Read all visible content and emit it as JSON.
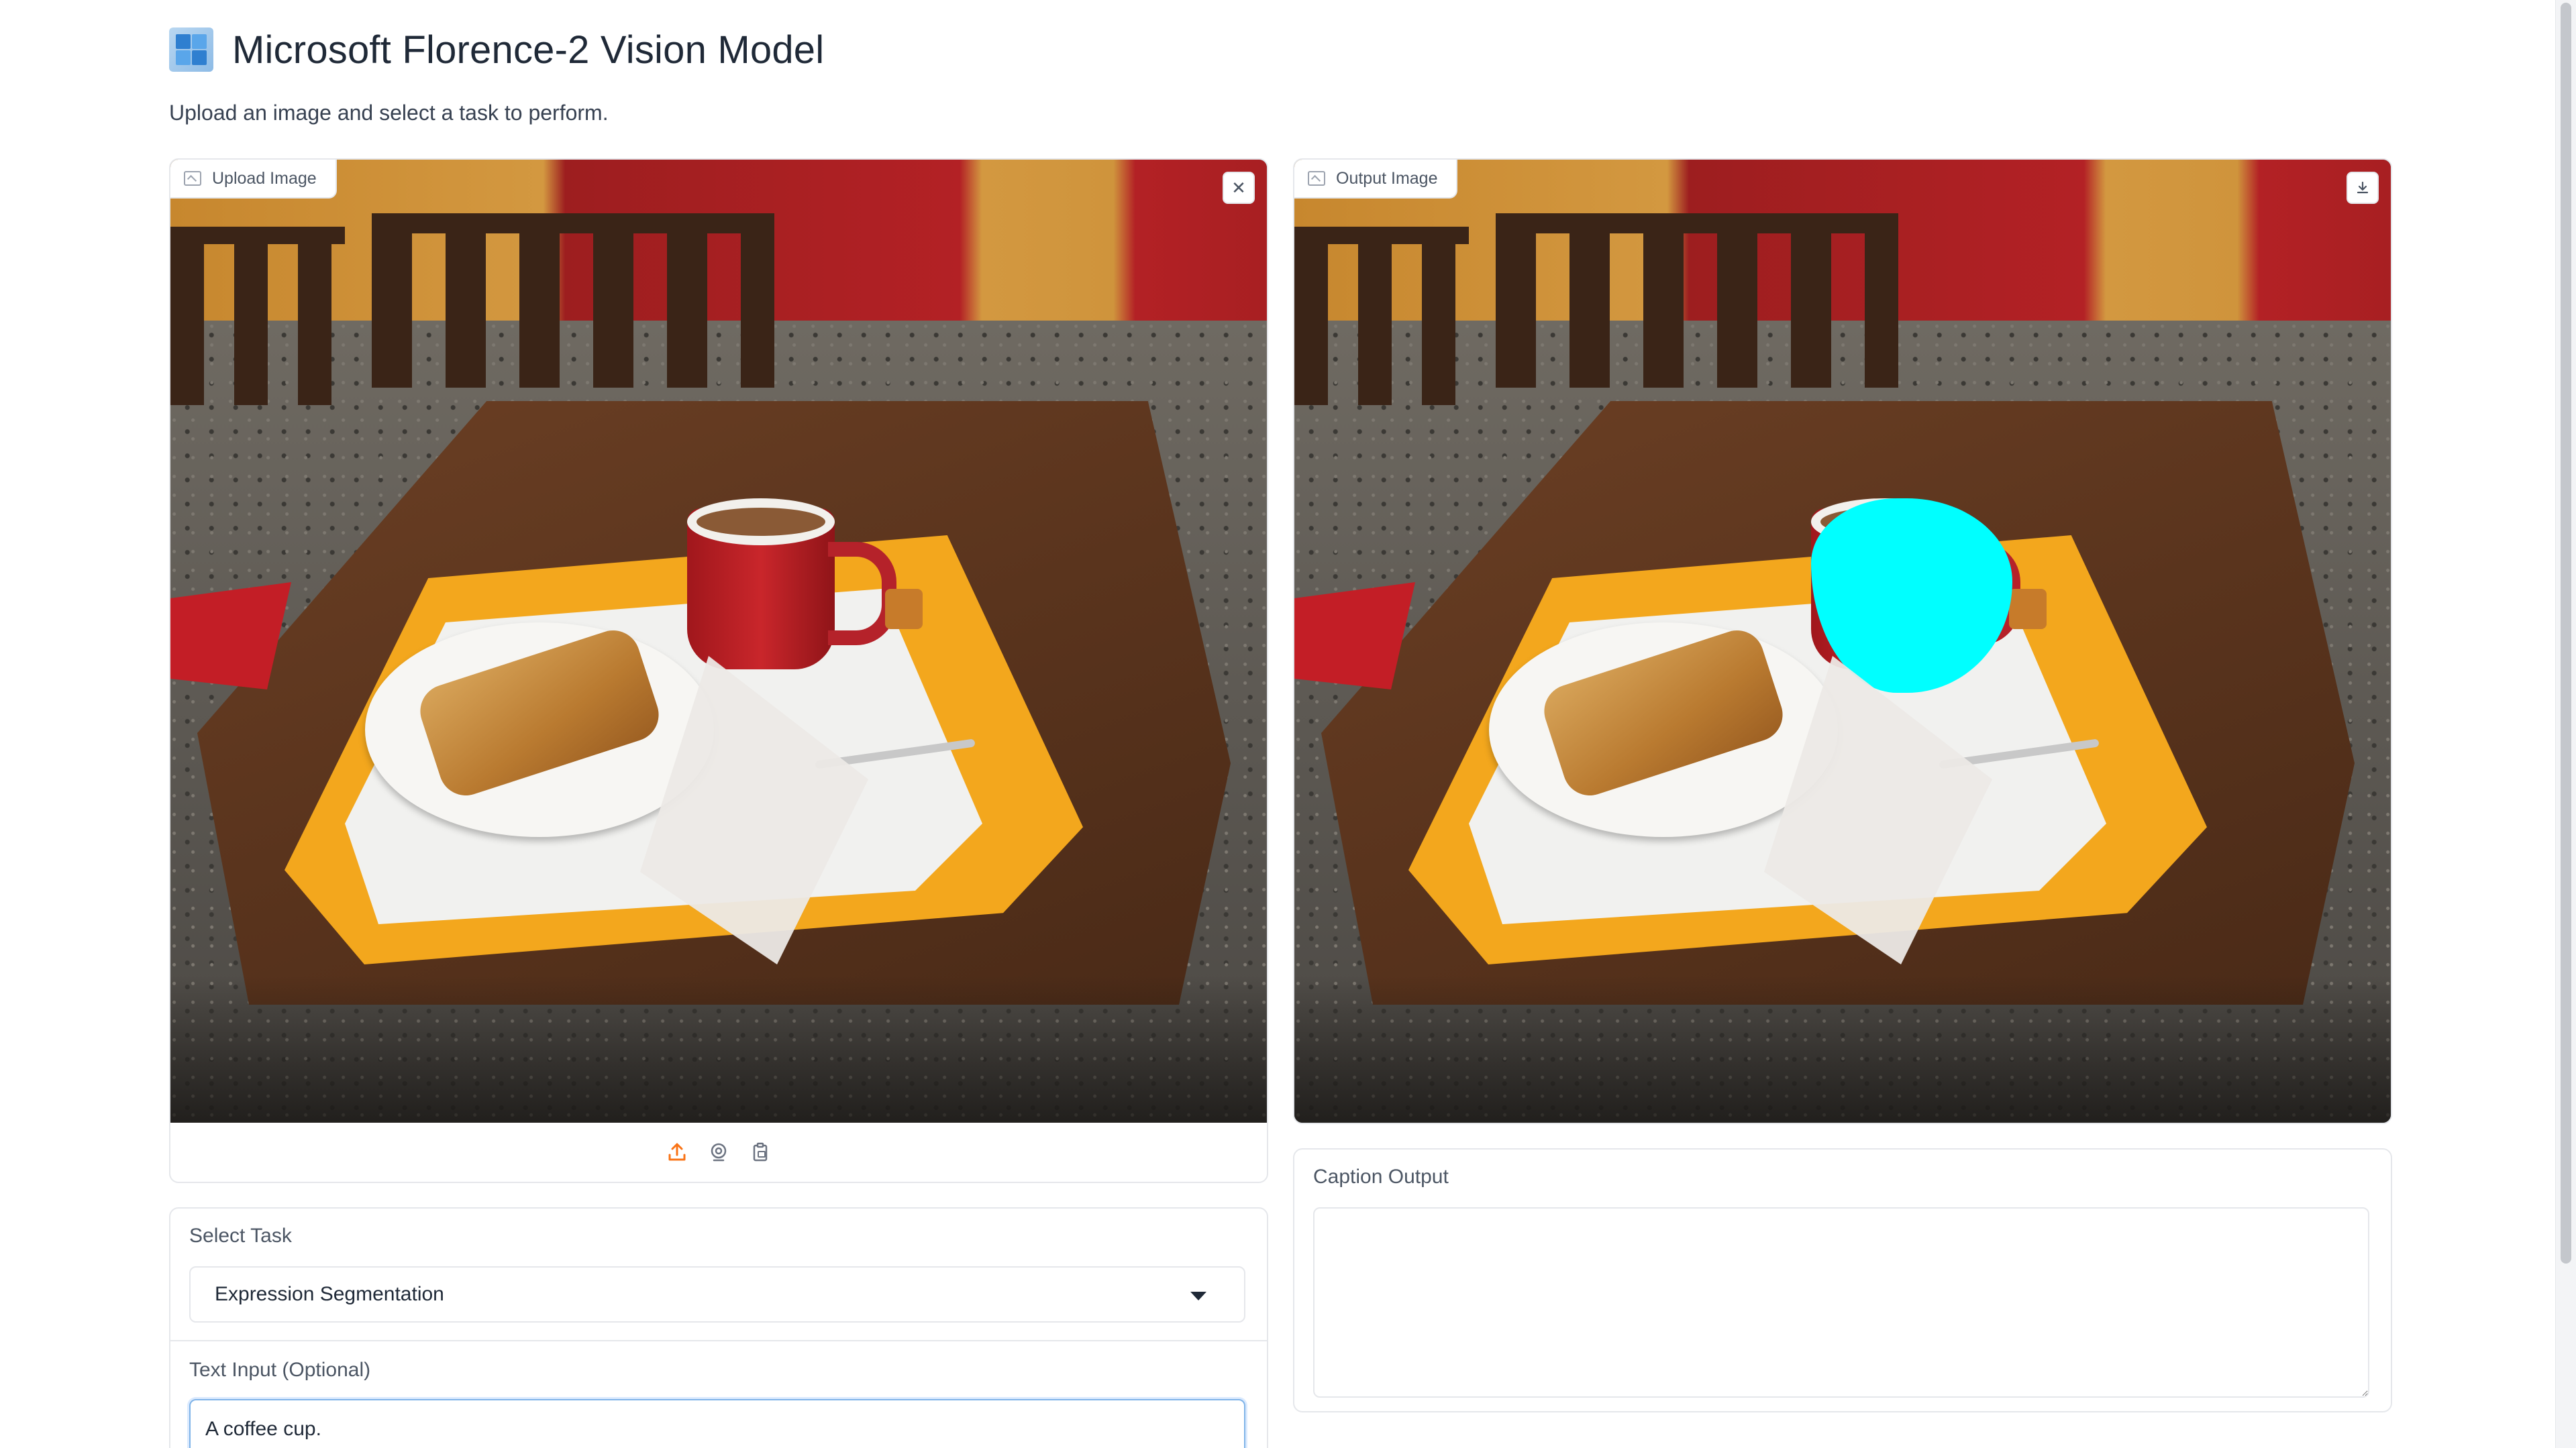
{
  "header": {
    "title": "Microsoft Florence-2 Vision Model",
    "subtitle": "Upload an image and select a task to perform."
  },
  "upload_panel": {
    "label": "Upload Image",
    "clear_icon": "close-icon",
    "toolbar_icons": [
      "upload-icon",
      "webcam-icon",
      "clipboard-icon"
    ]
  },
  "output_panel": {
    "label": "Output Image",
    "download_icon": "download-icon",
    "mask_color": "#00ffff"
  },
  "task": {
    "select_label": "Select Task",
    "selected_value": "Expression Segmentation",
    "text_input_label": "Text Input (Optional)",
    "text_input_value": "A coffee cup."
  },
  "caption": {
    "label": "Caption Output",
    "value": ""
  },
  "colors": {
    "accent": "#f97316",
    "border": "#e5e7eb",
    "focus": "#7fb3e8"
  }
}
